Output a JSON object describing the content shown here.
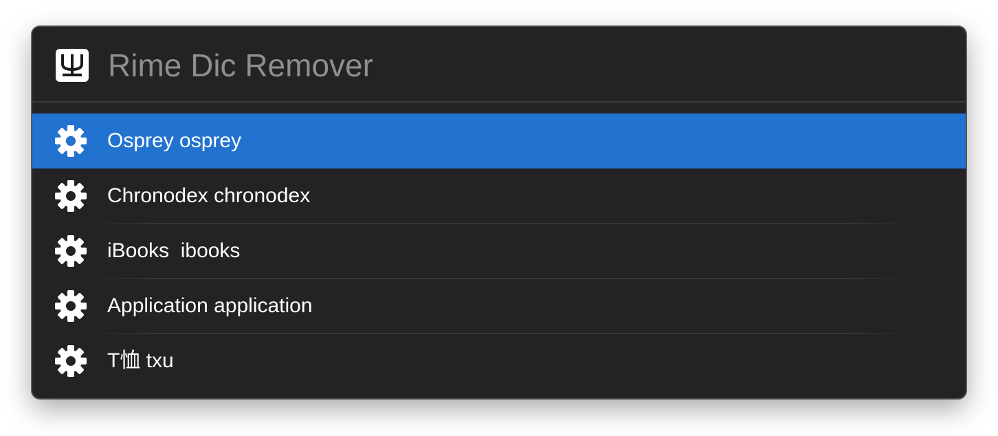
{
  "app": {
    "title": "Rime Dic Remover",
    "icon": "psi-icon",
    "icon_glyph": "Ψ"
  },
  "colors": {
    "window_bg": "#232323",
    "selected_bg": "#2272d0",
    "query_text": "#8e8e8e",
    "item_text": "#ffffff"
  },
  "results": [
    {
      "label": "Osprey osprey",
      "icon": "gear-icon",
      "selected": true
    },
    {
      "label": "Chronodex chronodex",
      "icon": "gear-icon",
      "selected": false
    },
    {
      "label": "iBooks  ibooks",
      "icon": "gear-icon",
      "selected": false
    },
    {
      "label": "Application application",
      "icon": "gear-icon",
      "selected": false
    },
    {
      "label": "T恤 txu",
      "icon": "gear-icon",
      "selected": false
    }
  ]
}
